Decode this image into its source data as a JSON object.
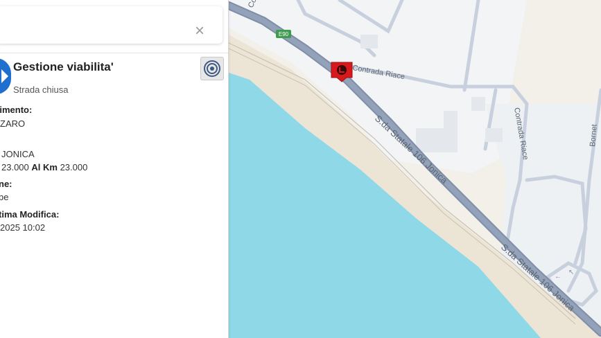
{
  "panel": {
    "close_label": "×",
    "event": {
      "title": "Gestione viabilita'",
      "subtitle": "Strada chiusa"
    },
    "fields": [
      {
        "label": "rtimento:",
        "value": "ZARO"
      },
      {
        "label": "",
        "value": "JONICA"
      },
      {
        "label": "",
        "km_from": "23.000",
        "km_to_label": "Al Km",
        "km_to": "23.000"
      },
      {
        "label": "ne:",
        "value": "be"
      },
      {
        "label": "tima Modifica:",
        "value": "2025 10:02"
      }
    ]
  },
  "map": {
    "road_labels": {
      "highway_main": "S.da Statale 106 Jonica",
      "highway_lower": "S.da Statale 106 Jonica",
      "road_shield": "E90",
      "contrada_riace_a": "Contrada Riace",
      "contrada_riace_b": "Contrada Riace",
      "bornet": "Bornet",
      "top_left": "Co"
    },
    "colors": {
      "sea": "#8fd8e8",
      "land": "#f3f0ea",
      "beach": "#ece5d6",
      "urban": "#f2f4f6",
      "road_main": "#8a99b0",
      "road_minor": "#c8d0de",
      "marker": "#d7191c",
      "icon_blue": "#1f6fcf"
    },
    "marker_icon": "road-closed-icon"
  }
}
